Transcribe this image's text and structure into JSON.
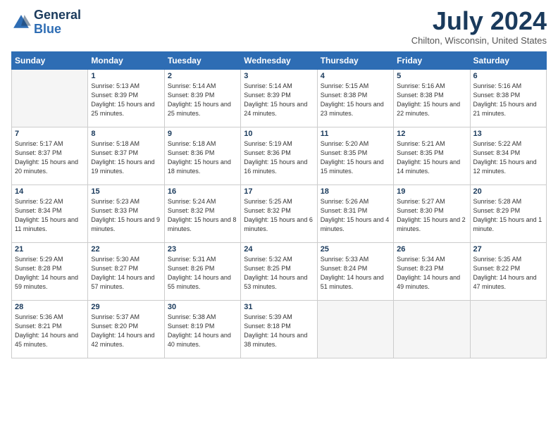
{
  "header": {
    "logo_general": "General",
    "logo_blue": "Blue",
    "month_year": "July 2024",
    "location": "Chilton, Wisconsin, United States"
  },
  "days_of_week": [
    "Sunday",
    "Monday",
    "Tuesday",
    "Wednesday",
    "Thursday",
    "Friday",
    "Saturday"
  ],
  "weeks": [
    [
      {
        "day": "",
        "sunrise": "",
        "sunset": "",
        "daylight": ""
      },
      {
        "day": "1",
        "sunrise": "Sunrise: 5:13 AM",
        "sunset": "Sunset: 8:39 PM",
        "daylight": "Daylight: 15 hours and 25 minutes."
      },
      {
        "day": "2",
        "sunrise": "Sunrise: 5:14 AM",
        "sunset": "Sunset: 8:39 PM",
        "daylight": "Daylight: 15 hours and 25 minutes."
      },
      {
        "day": "3",
        "sunrise": "Sunrise: 5:14 AM",
        "sunset": "Sunset: 8:39 PM",
        "daylight": "Daylight: 15 hours and 24 minutes."
      },
      {
        "day": "4",
        "sunrise": "Sunrise: 5:15 AM",
        "sunset": "Sunset: 8:38 PM",
        "daylight": "Daylight: 15 hours and 23 minutes."
      },
      {
        "day": "5",
        "sunrise": "Sunrise: 5:16 AM",
        "sunset": "Sunset: 8:38 PM",
        "daylight": "Daylight: 15 hours and 22 minutes."
      },
      {
        "day": "6",
        "sunrise": "Sunrise: 5:16 AM",
        "sunset": "Sunset: 8:38 PM",
        "daylight": "Daylight: 15 hours and 21 minutes."
      }
    ],
    [
      {
        "day": "7",
        "sunrise": "Sunrise: 5:17 AM",
        "sunset": "Sunset: 8:37 PM",
        "daylight": "Daylight: 15 hours and 20 minutes."
      },
      {
        "day": "8",
        "sunrise": "Sunrise: 5:18 AM",
        "sunset": "Sunset: 8:37 PM",
        "daylight": "Daylight: 15 hours and 19 minutes."
      },
      {
        "day": "9",
        "sunrise": "Sunrise: 5:18 AM",
        "sunset": "Sunset: 8:36 PM",
        "daylight": "Daylight: 15 hours and 18 minutes."
      },
      {
        "day": "10",
        "sunrise": "Sunrise: 5:19 AM",
        "sunset": "Sunset: 8:36 PM",
        "daylight": "Daylight: 15 hours and 16 minutes."
      },
      {
        "day": "11",
        "sunrise": "Sunrise: 5:20 AM",
        "sunset": "Sunset: 8:35 PM",
        "daylight": "Daylight: 15 hours and 15 minutes."
      },
      {
        "day": "12",
        "sunrise": "Sunrise: 5:21 AM",
        "sunset": "Sunset: 8:35 PM",
        "daylight": "Daylight: 15 hours and 14 minutes."
      },
      {
        "day": "13",
        "sunrise": "Sunrise: 5:22 AM",
        "sunset": "Sunset: 8:34 PM",
        "daylight": "Daylight: 15 hours and 12 minutes."
      }
    ],
    [
      {
        "day": "14",
        "sunrise": "Sunrise: 5:22 AM",
        "sunset": "Sunset: 8:34 PM",
        "daylight": "Daylight: 15 hours and 11 minutes."
      },
      {
        "day": "15",
        "sunrise": "Sunrise: 5:23 AM",
        "sunset": "Sunset: 8:33 PM",
        "daylight": "Daylight: 15 hours and 9 minutes."
      },
      {
        "day": "16",
        "sunrise": "Sunrise: 5:24 AM",
        "sunset": "Sunset: 8:32 PM",
        "daylight": "Daylight: 15 hours and 8 minutes."
      },
      {
        "day": "17",
        "sunrise": "Sunrise: 5:25 AM",
        "sunset": "Sunset: 8:32 PM",
        "daylight": "Daylight: 15 hours and 6 minutes."
      },
      {
        "day": "18",
        "sunrise": "Sunrise: 5:26 AM",
        "sunset": "Sunset: 8:31 PM",
        "daylight": "Daylight: 15 hours and 4 minutes."
      },
      {
        "day": "19",
        "sunrise": "Sunrise: 5:27 AM",
        "sunset": "Sunset: 8:30 PM",
        "daylight": "Daylight: 15 hours and 2 minutes."
      },
      {
        "day": "20",
        "sunrise": "Sunrise: 5:28 AM",
        "sunset": "Sunset: 8:29 PM",
        "daylight": "Daylight: 15 hours and 1 minute."
      }
    ],
    [
      {
        "day": "21",
        "sunrise": "Sunrise: 5:29 AM",
        "sunset": "Sunset: 8:28 PM",
        "daylight": "Daylight: 14 hours and 59 minutes."
      },
      {
        "day": "22",
        "sunrise": "Sunrise: 5:30 AM",
        "sunset": "Sunset: 8:27 PM",
        "daylight": "Daylight: 14 hours and 57 minutes."
      },
      {
        "day": "23",
        "sunrise": "Sunrise: 5:31 AM",
        "sunset": "Sunset: 8:26 PM",
        "daylight": "Daylight: 14 hours and 55 minutes."
      },
      {
        "day": "24",
        "sunrise": "Sunrise: 5:32 AM",
        "sunset": "Sunset: 8:25 PM",
        "daylight": "Daylight: 14 hours and 53 minutes."
      },
      {
        "day": "25",
        "sunrise": "Sunrise: 5:33 AM",
        "sunset": "Sunset: 8:24 PM",
        "daylight": "Daylight: 14 hours and 51 minutes."
      },
      {
        "day": "26",
        "sunrise": "Sunrise: 5:34 AM",
        "sunset": "Sunset: 8:23 PM",
        "daylight": "Daylight: 14 hours and 49 minutes."
      },
      {
        "day": "27",
        "sunrise": "Sunrise: 5:35 AM",
        "sunset": "Sunset: 8:22 PM",
        "daylight": "Daylight: 14 hours and 47 minutes."
      }
    ],
    [
      {
        "day": "28",
        "sunrise": "Sunrise: 5:36 AM",
        "sunset": "Sunset: 8:21 PM",
        "daylight": "Daylight: 14 hours and 45 minutes."
      },
      {
        "day": "29",
        "sunrise": "Sunrise: 5:37 AM",
        "sunset": "Sunset: 8:20 PM",
        "daylight": "Daylight: 14 hours and 42 minutes."
      },
      {
        "day": "30",
        "sunrise": "Sunrise: 5:38 AM",
        "sunset": "Sunset: 8:19 PM",
        "daylight": "Daylight: 14 hours and 40 minutes."
      },
      {
        "day": "31",
        "sunrise": "Sunrise: 5:39 AM",
        "sunset": "Sunset: 8:18 PM",
        "daylight": "Daylight: 14 hours and 38 minutes."
      },
      {
        "day": "",
        "sunrise": "",
        "sunset": "",
        "daylight": ""
      },
      {
        "day": "",
        "sunrise": "",
        "sunset": "",
        "daylight": ""
      },
      {
        "day": "",
        "sunrise": "",
        "sunset": "",
        "daylight": ""
      }
    ]
  ]
}
